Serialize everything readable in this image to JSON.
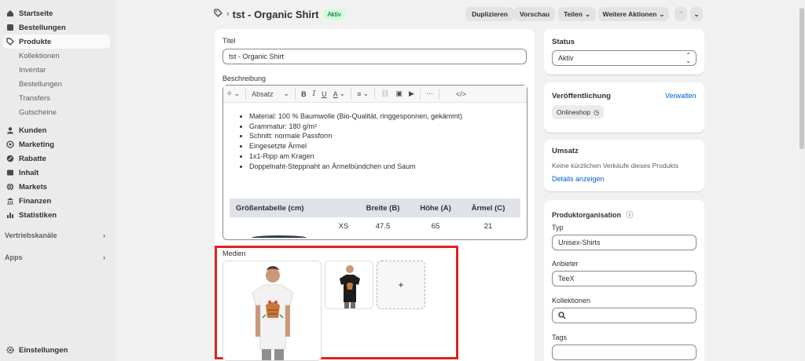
{
  "sidebar": {
    "items": [
      {
        "label": "Startseite",
        "icon": "home-icon"
      },
      {
        "label": "Bestellungen",
        "icon": "inbox-icon"
      },
      {
        "label": "Produkte",
        "icon": "tag-icon"
      },
      {
        "label": "Kunden",
        "icon": "person-icon"
      },
      {
        "label": "Marketing",
        "icon": "target-icon"
      },
      {
        "label": "Rabatte",
        "icon": "discount-icon"
      },
      {
        "label": "Inhalt",
        "icon": "content-icon"
      },
      {
        "label": "Markets",
        "icon": "globe-icon"
      },
      {
        "label": "Finanzen",
        "icon": "bank-icon"
      },
      {
        "label": "Statistiken",
        "icon": "chart-icon"
      }
    ],
    "product_subitems": [
      "Kollektionen",
      "Inventar",
      "Bestellungen",
      "Transfers",
      "Gutscheine"
    ],
    "sales_channels": "Vertriebskanäle",
    "apps": "Apps",
    "settings": "Einstellungen"
  },
  "header": {
    "breadcrumb_sep": "›",
    "title": "tst - Organic Shirt",
    "status_badge": "Aktiv",
    "buttons": {
      "duplicate": "Duplizieren",
      "preview": "Vorschau",
      "share": "Teilen",
      "more_actions": "Weitere Aktionen"
    }
  },
  "product": {
    "title_label": "Titel",
    "title_value": "tst  - Organic Shirt",
    "description_label": "Beschreibung",
    "paragraph_style": "Absatz",
    "bullets": [
      "Material: 100 % Baumwolle (Bio-Qualität, ringgesponnen, gekämmt)",
      "Grammatur: 180 g/m²",
      "Schnitt: normale Passform",
      "Eingesetzte Ärmel",
      "1x1-Ripp am Kragen",
      "Doppelnaht-Steppnaht an Ärmelbündchen und Saum"
    ],
    "size_table": {
      "headers": [
        "Größentabelle (cm)",
        "Breite (B)",
        "Höhe (A)",
        "Ärmel (C)"
      ],
      "rows": [
        [
          "",
          "XS",
          "47.5",
          "65",
          "21"
        ]
      ]
    },
    "media_label": "Medien",
    "add_media": "+"
  },
  "right": {
    "status_label": "Status",
    "status_value": "Aktiv",
    "publishing_label": "Veröffentlichung",
    "manage_link": "Verwalten",
    "channel": "Onlineshop",
    "sales_label": "Umsatz",
    "sales_text": "Keine kürzlichen Verkäufe dieses Produkts",
    "details_link": "Details anzeigen",
    "org_label": "Produktorganisation",
    "type_label": "Typ",
    "type_value": "Unisex-Shirts",
    "vendor_label": "Anbieter",
    "vendor_value": "TeeX",
    "collections_label": "Kollektionen",
    "tags_label": "Tags"
  },
  "colors": {
    "accent": "#005bd3",
    "badge_bg": "#cdfed4",
    "highlight": "#e0221f"
  }
}
